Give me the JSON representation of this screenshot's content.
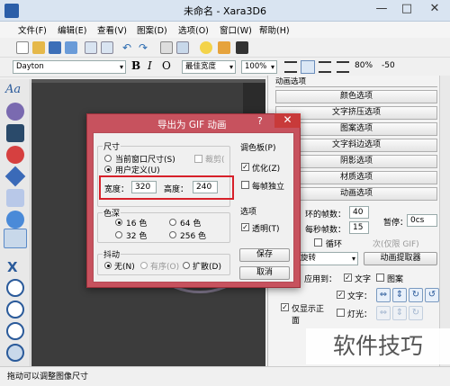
{
  "window": {
    "title": "未命名 - Xara3D6",
    "minimize": "—",
    "maximize": "□",
    "close": "✕"
  },
  "menu": [
    "文件(F)",
    "编辑(E)",
    "查看(V)",
    "图案(D)",
    "选项(O)",
    "窗口(W)",
    "帮助(H)"
  ],
  "toolbar2": {
    "font": "Dayton",
    "bold": "B",
    "italic": "I",
    "outline": "O",
    "width_mode": "最佳宽度",
    "zoom": "100%",
    "spacing": "80%",
    "offset": "-50"
  },
  "left_tools": [
    "Aa"
  ],
  "side_panel": {
    "header": "动画选项",
    "buttons": [
      "颜色选项",
      "文字挤压选项",
      "图案选项",
      "文字斜边选项",
      "阴影选项",
      "材质选项",
      "动画选项"
    ],
    "frames_label": "环的帧数：",
    "frames_value": "40",
    "fps_label": "每秒帧数：",
    "fps_value": "15",
    "pause_label": "暂停：",
    "pause_value": "0cs",
    "loop_label": "循环",
    "times_label": "次(仅限 GIF)",
    "type_value": "旋转",
    "extractor_label": "动画提取器",
    "apply_label": "应用到：",
    "text_label": "文字",
    "pattern_label": "图案",
    "text2_label": "文字：",
    "light_label": "灯光：",
    "show_only_label": "仅显示正面"
  },
  "dialog": {
    "title": "导出为 GIF 动画",
    "help": "?",
    "close": "✕",
    "size_group": "尺寸",
    "current_size": "当前窗口尺寸(S)",
    "crop": "裁剪(",
    "custom": "用户定义(U)",
    "width_label": "宽度：",
    "width_value": "320",
    "height_label": "高度：",
    "height_value": "240",
    "palette_group": "调色板(P)",
    "optimize": "优化(Z)",
    "per_frame": "每帧独立",
    "color_group": "色深",
    "c16": "16 色",
    "c64": "64 色",
    "c32": "32 色",
    "c256": "256 色",
    "options_group": "选项",
    "transparent": "透明(T)",
    "dither_group": "抖动",
    "dither_none": "无(N)",
    "dither_ordered": "有序(O)",
    "dither_diffuse": "扩散(D)",
    "save": "保存",
    "cancel": "取消"
  },
  "status": "拖动可以调整图像尺寸",
  "watermark": "软件技巧",
  "colors": {
    "dialog_frame": "#c7525e",
    "highlight": "#d7202a",
    "titlebar": "#d9e4f1"
  }
}
